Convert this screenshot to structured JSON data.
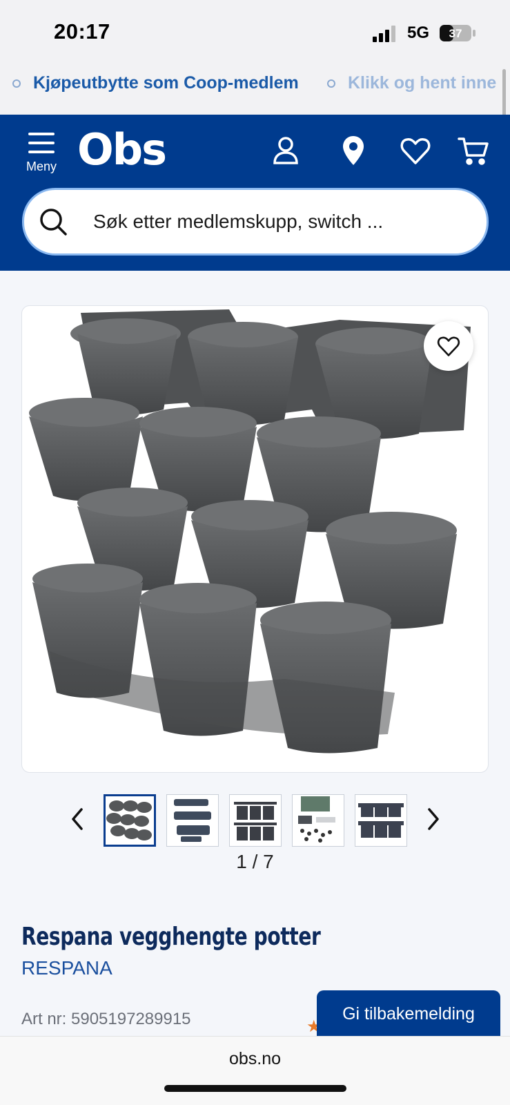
{
  "status": {
    "time": "20:17",
    "network": "5G",
    "battery": "37"
  },
  "ticker": {
    "item1": "Kjøpeutbytte som Coop-medlem",
    "item2": "Klikk og hent inne"
  },
  "header": {
    "menu_label": "Meny",
    "logo": "Obs"
  },
  "search": {
    "placeholder": "Søk etter medlemskupp, switch ..."
  },
  "gallery": {
    "counter": "1 / 7"
  },
  "product": {
    "title": "Respana vegghengte potter",
    "brand": "RESPANA",
    "art_nr": "Art nr: 5905197289915"
  },
  "feedback": {
    "label": "Gi tilbakemelding"
  },
  "browser": {
    "url": "obs.no"
  },
  "colors": {
    "brand_blue": "#003b8e",
    "link_blue": "#1a4f9e",
    "pot_gray": "#555759"
  }
}
